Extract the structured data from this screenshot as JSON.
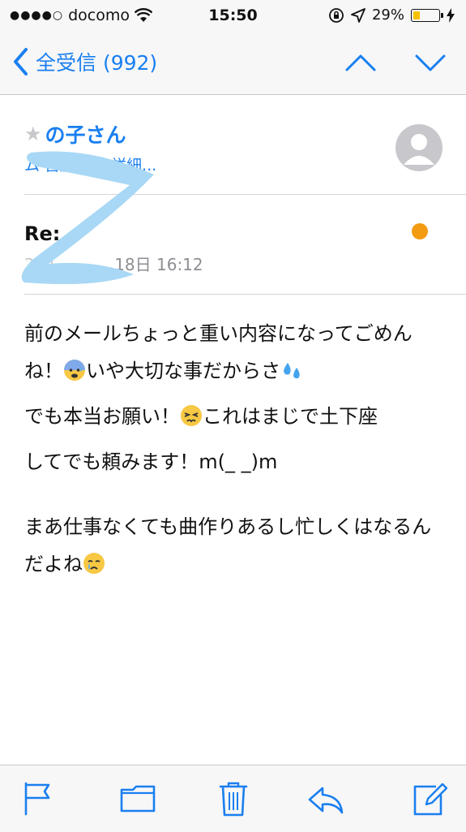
{
  "status_bar": {
    "signal_dots": "●●●●○",
    "carrier": "docomo",
    "time": "15:50",
    "battery_percent": "29%",
    "battery_level": 0.29
  },
  "nav": {
    "back_label": "全受信 (992)"
  },
  "message": {
    "sender": "の子さん",
    "recipients": "宛先",
    "recipients_redacted": "ム 宮藤瑞菜",
    "details_link": "詳細...",
    "subject": "Re:",
    "date": "2016年5月18日 16:12",
    "date_visible": "18日 16:12",
    "paragraphs": [
      {
        "text_before": "前のメールちょっと重い内容になってごめんね！",
        "emoji1": "anxious-face",
        "text_middle": "いや大切な事だからさ",
        "emoji2": "sweat-droplets"
      },
      {
        "text_before": "でも本当お願い！",
        "emoji1": "persevering-face",
        "text_middle": "これはまじで土下座"
      },
      {
        "text_before": "してでも頼みます！m(_ _)m"
      },
      {
        "text_before": "まあ仕事なくても曲作りあるし忙しくはなるんだよね",
        "emoji1": "crying-face"
      }
    ]
  },
  "toolbar": {
    "items": [
      "flag-icon",
      "folder-icon",
      "trash-icon",
      "reply-icon",
      "compose-icon"
    ]
  },
  "colors": {
    "accent": "#1a7ff0",
    "unread": "#f39c12",
    "scribble": "#a8d8f5",
    "battery": "#f5c000"
  }
}
